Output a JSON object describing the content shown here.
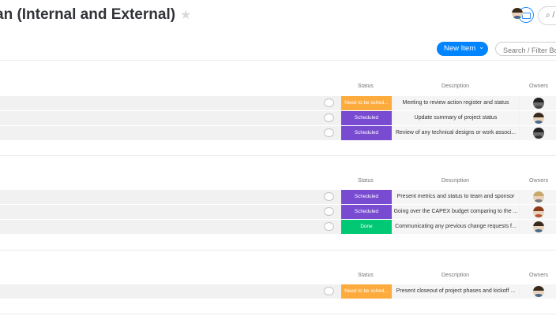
{
  "header": {
    "title": "an (Internal and External)",
    "star_icon": "star-icon",
    "search_label": "⌕ /"
  },
  "toolbar": {
    "new_item_label": "New Item",
    "new_item_chevron": "⌄",
    "filter_placeholder": "Search / Filter Board"
  },
  "colors": {
    "accent": "#0085ff",
    "status_need": "#fdab3d",
    "status_scheduled": "#784bd1",
    "status_done": "#00c875"
  },
  "columns": {
    "status": "Status",
    "description": "Description",
    "owners": "Owners"
  },
  "groups": [
    {
      "rows": [
        {
          "status": "Need to be sched...",
          "status_kind": "need",
          "description": "Meeting to review action register and status"
        },
        {
          "status": "Scheduled",
          "status_kind": "scheduled",
          "description": "Update summary of project status"
        },
        {
          "status": "Scheduled",
          "status_kind": "scheduled",
          "description": "Review of any technical designs or work associ..."
        }
      ]
    },
    {
      "rows": [
        {
          "status": "Scheduled",
          "status_kind": "scheduled",
          "description": "Present metrics and status to team and sponsor"
        },
        {
          "status": "Scheduled",
          "status_kind": "scheduled",
          "description": "Going over the CAPEX budget comparing to the ..."
        },
        {
          "status": "Done",
          "status_kind": "done",
          "description": "Communicating any previous change requests f..."
        }
      ]
    },
    {
      "rows": [
        {
          "status": "Need to be sched...",
          "status_kind": "need",
          "description": "Present closeout of project phases and kickoff ..."
        }
      ]
    }
  ]
}
